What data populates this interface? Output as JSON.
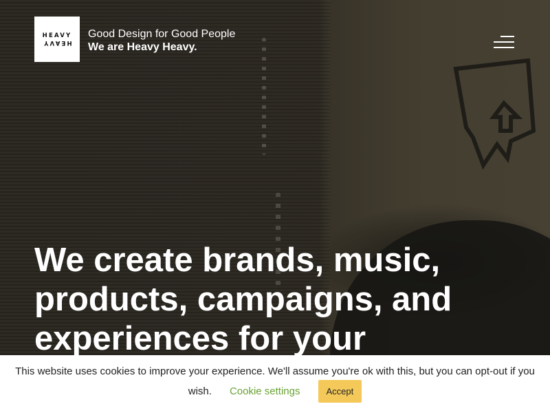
{
  "brand": {
    "logo_top": "HEAVY",
    "logo_bottom": "HEAVY",
    "tagline_line1": "Good Design for Good People",
    "tagline_line2": "We are Heavy Heavy."
  },
  "hero": {
    "headline_line1": "We create brands, music,",
    "headline_line2": "products, campaigns, and",
    "headline_line3": "experiences for your"
  },
  "cookie_banner": {
    "message_part1": "This website uses cookies to improve your experience. We'll assume you're ok with this, but you can opt-out if you",
    "message_part2": "wish.",
    "settings_link": "Cookie settings",
    "accept_label": "Accept"
  },
  "colors": {
    "accept_button": "#f4c95a",
    "settings_link": "#6aa234",
    "logo_background": "#ffffff"
  },
  "icons": {
    "menu": "hamburger-menu-icon"
  }
}
